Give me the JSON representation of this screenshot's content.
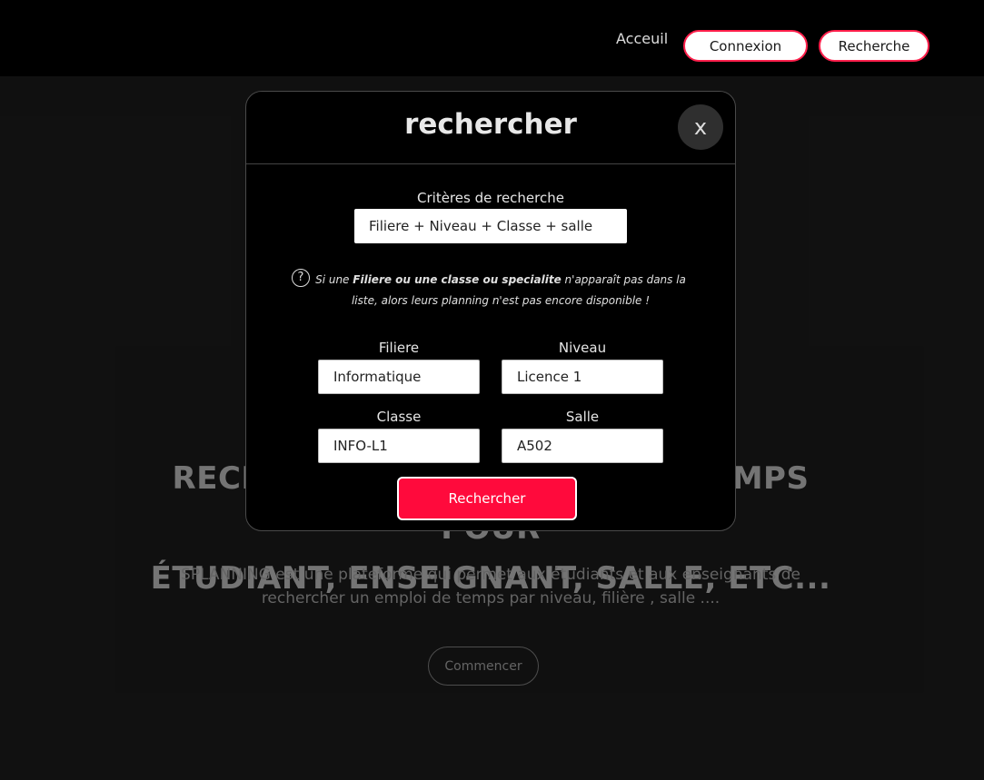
{
  "nav": {
    "home_label": "Acceuil",
    "login_label": "Connexion",
    "search_label": "Recherche"
  },
  "hero": {
    "title_line1": "RECHERCHEZ UN EMPLOI DU TEMPS POUR",
    "title_line2": "ÉTUDIANT, ENSEIGNANT, SALLE, ETC...",
    "description": "SPLANNING est une plateforme qui permet aux étudiants et aux enseignants de rechercher un emploi de temps par niveau, filière , salle ....",
    "start_label": "Commencer"
  },
  "modal": {
    "title": "rechercher",
    "close_label": "x",
    "criteria_label": "Critères de recherche",
    "criteria_value": "Filiere + Niveau + Classe + salle",
    "help_icon": "question-circle-icon",
    "help_prefix": "Si une ",
    "help_bold": "Filiere ou une classe ou specialite",
    "help_suffix": " n'apparaît pas dans la liste, alors leurs planning n'est pas encore disponible !",
    "fields": {
      "filiere": {
        "label": "Filiere",
        "value": "Informatique"
      },
      "niveau": {
        "label": "Niveau",
        "value": "Licence 1"
      },
      "classe": {
        "label": "Classe",
        "value": "INFO-L1"
      },
      "salle": {
        "label": "Salle",
        "value": "A502"
      }
    },
    "submit_label": "Rechercher"
  },
  "colors": {
    "accent": "#ff0a3c",
    "background": "#1a1a1a",
    "navbar": "#000000"
  }
}
